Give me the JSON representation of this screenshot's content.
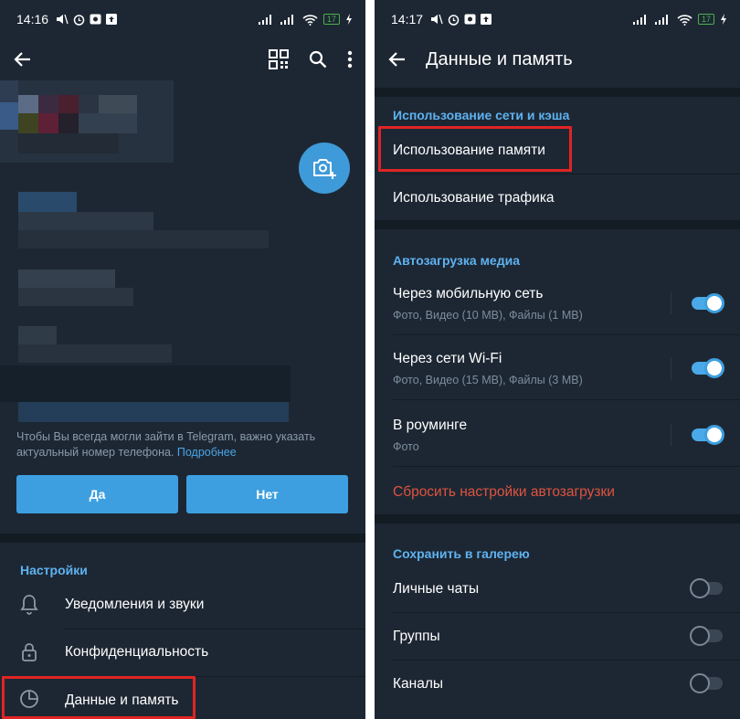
{
  "left": {
    "status": {
      "time": "14:16"
    },
    "hint": {
      "text": "Чтобы Вы всегда могли зайти в Telegram, важно указать актуальный номер телефона.",
      "link": "Подробнее"
    },
    "buttons": {
      "yes": "Да",
      "no": "Нет"
    },
    "settings_header": "Настройки",
    "menu": {
      "notifications": "Уведомления и звуки",
      "privacy": "Конфиденциальность",
      "data": "Данные и память"
    }
  },
  "right": {
    "status": {
      "time": "14:17"
    },
    "title": "Данные и память",
    "network_header": "Использование сети и кэша",
    "memory_usage": "Использование памяти",
    "traffic_usage": "Использование трафика",
    "autoload_header": "Автозагрузка медиа",
    "mobile": {
      "label": "Через мобильную сеть",
      "sub": "Фото, Видео (10 MB), Файлы (1 MB)"
    },
    "wifi": {
      "label": "Через сети Wi-Fi",
      "sub": "Фото, Видео (15 MB), Файлы (3 MB)"
    },
    "roaming": {
      "label": "В роуминге",
      "sub": "Фото"
    },
    "reset": "Сбросить настройки автозагрузки",
    "gallery_header": "Сохранить в галерею",
    "personal": "Личные чаты",
    "groups": "Группы",
    "channels": "Каналы"
  },
  "battery": "17",
  "colors": {
    "background": "#1d2733",
    "accent": "#5eb2f0",
    "button": "#3d9fe0",
    "danger": "#e0533f",
    "highlight": "#e02424"
  },
  "icons": [
    "back-arrow-icon",
    "qr-code-icon",
    "search-icon",
    "more-vert-icon",
    "camera-add-icon",
    "bell-icon",
    "lock-icon",
    "pie-chart-icon",
    "wifi-icon",
    "signal-icon",
    "battery-icon"
  ]
}
